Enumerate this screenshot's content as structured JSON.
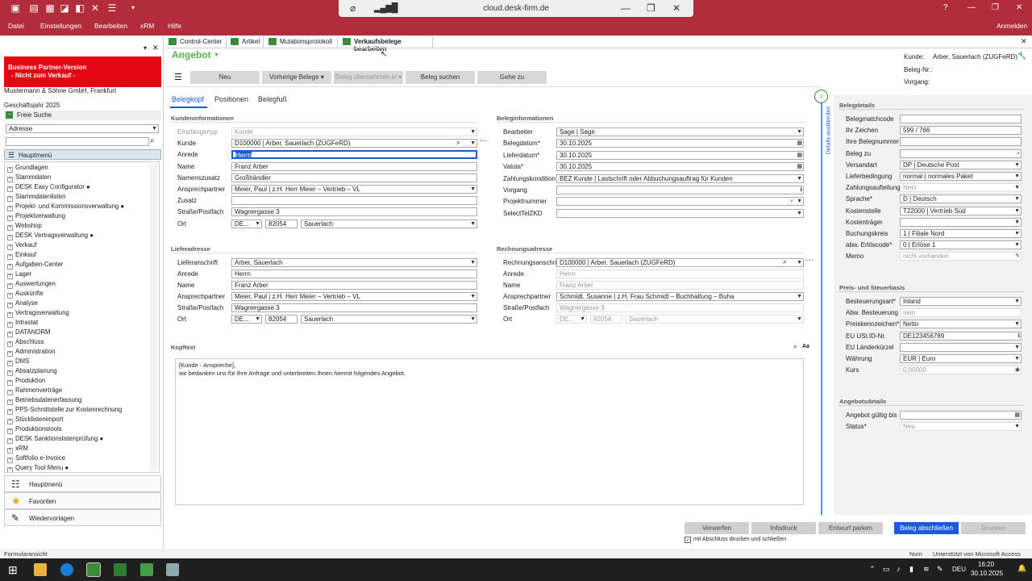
{
  "quick_access": {
    "icons": [
      "save-icon",
      "document-icon",
      "table-icon",
      "edit-icon",
      "back-icon",
      "close-icon",
      "layout-icon",
      "more-icon"
    ]
  },
  "cloud": {
    "host": "cloud.desk-firm.de"
  },
  "menu": [
    "Datei",
    "Einstellungen",
    "Bearbeiten",
    "xRM",
    "Hilfe"
  ],
  "window": {
    "help": "?",
    "login": "Anmelden"
  },
  "left": {
    "banner_line1": "Business Partner-Version",
    "banner_line2": "- Nicht zum Verkauf -",
    "company": "Mustermann & Söhne GmbH, Frankfurt",
    "fiscal": "Geschäftsjahr 2025",
    "search_title": "Freie Suche",
    "search_type": "Adresse",
    "search_value": "",
    "main_menu": "Hauptmenü",
    "tree": [
      "Grundlagen",
      "Stammdaten",
      "DESK Easy Configurator ●",
      "Stammdatenlisten",
      "Projekt- und Kommissionsverwaltung ●",
      "Projektverwaltung",
      "Webshop",
      "DESK Vertragsverwaltung ●",
      "Verkauf",
      "Einkauf",
      "Aufgaben-Center",
      "Lager",
      "Auswertungen",
      "Auskünfte",
      "Analyse",
      "Vertragsverwaltung",
      "Intrastat",
      "DATANORM",
      "Abschluss",
      "Administration",
      "DMS",
      "Absatzplanung",
      "Produktion",
      "Rahmenverträge",
      "Betriebsdatenerfassung",
      "PPS-Schnittstelle zur Kostenrechnung",
      "Stücklistenimport",
      "Produktionstools",
      "DESK Sanktionslistenprüfung ●",
      "xRM",
      "Softfolio e-Invoice",
      "Query Tool Menu ●"
    ],
    "nav": [
      "Hauptmenü",
      "Favoriten",
      "Wiedervorlagen"
    ]
  },
  "tabs": [
    "Control-Center",
    "Artikel",
    "Mutationsprotokoll",
    "Verkaufsbelege bearbeiten"
  ],
  "doc_title": "Angebot",
  "toolbar": {
    "neu": "Neu",
    "vorherige": "Vorherige Belege",
    "uebernehmen": "Beleg übernehmen in",
    "suchen": "Beleg suchen",
    "gehe": "Gehe zu"
  },
  "info": {
    "kunde_label": "Kunde:",
    "kunde_value": "Arber, Sauerlach (ZUGFeRD)",
    "belegnr_label": "Beleg-Nr.:",
    "vorgang_label": "Vorgang:"
  },
  "subtabs": [
    "Belegkopf",
    "Positionen",
    "Belegfuß"
  ],
  "kunden": {
    "title": "Kundeninformationen",
    "rows": [
      {
        "label": "Empfängertyp",
        "value": "Kunde",
        "gray": true
      },
      {
        "label": "Kunde",
        "value": "D100000 | Arber, Sauerlach (ZUGFeRD)"
      },
      {
        "label": "Anrede",
        "value": "Herrn"
      },
      {
        "label": "Name",
        "value": "Franz Arber"
      },
      {
        "label": "Namenszusatz",
        "value": "Großhändler"
      },
      {
        "label": "Ansprechpartner",
        "value": "Meier, Paul | z.H. Herr Meier – Vertrieb – VL"
      },
      {
        "label": "Zusatz",
        "value": ""
      },
      {
        "label": "Straße/Postfach",
        "value": "Wagnergasse 3"
      },
      {
        "label": "Ort",
        "country": "DE...",
        "plz": "82054",
        "city": "Sauerlach"
      }
    ]
  },
  "beleg": {
    "title": "Beleginformationen",
    "rows": [
      {
        "label": "Bearbeiter",
        "value": "Sage | Sage"
      },
      {
        "label": "Belegdatum*",
        "value": "30.10.2025"
      },
      {
        "label": "Lieferdatum*",
        "value": "30.10.2025"
      },
      {
        "label": "Valuta*",
        "value": "30.10.2025"
      },
      {
        "label": "Zahlungskondition",
        "value": "BEZ Kunde | Lastschrift oder Abbuchungsauftrag für Kunden"
      },
      {
        "label": "Vorgang",
        "value": ""
      },
      {
        "label": "Projektnummer",
        "value": ""
      },
      {
        "label": "SelectTelZKD",
        "value": ""
      }
    ]
  },
  "liefer": {
    "title": "Lieferadresse",
    "rows": [
      {
        "label": "Lieferanschrift",
        "value": "Arber, Sauerlach"
      },
      {
        "label": "Anrede",
        "value": "Herrn"
      },
      {
        "label": "Name",
        "value": "Franz Arber"
      },
      {
        "label": "Ansprechpartner",
        "value": "Meier, Paul | z.H. Herr Meier – Vertrieb – VL"
      },
      {
        "label": "Straße/Postfach",
        "value": "Wagnergasse 3"
      },
      {
        "label": "Ort",
        "country": "DE...",
        "plz": "82054",
        "city": "Sauerlach"
      }
    ]
  },
  "rechnung": {
    "title": "Rechnungsadresse",
    "rows": [
      {
        "label": "Rechnungsanschrift",
        "value": "D100000 | Arber, Sauerlach (ZUGFeRD)"
      },
      {
        "label": "Anrede",
        "value": "Herrn",
        "gray": true
      },
      {
        "label": "Name",
        "value": "Franz Arber",
        "gray": true
      },
      {
        "label": "Ansprechpartner",
        "value": "Schmidt, Susanne | z.H. Frau Schmidt – Buchhaltung – Buha"
      },
      {
        "label": "Straße/Postfach",
        "value": "Wagnergasse 3",
        "gray": true
      },
      {
        "label": "Ort",
        "country": "DE...",
        "plz": "82054",
        "city": "Sauerlach",
        "gray": true
      }
    ]
  },
  "kopftext": {
    "title": "Kopftext",
    "line1": "[Kunde - Anspreche],",
    "line2": "wir bedanken uns für Ihre Anfrage und unterbreiten Ihnen hiermit folgendes Angebot.",
    "aa": "Aa"
  },
  "details_toggle": "Details ausblenden",
  "right": {
    "belegdetails_title": "Belegdetails",
    "belegdetails": [
      {
        "label": "Belegmatchcode",
        "value": ""
      },
      {
        "label": "Ihr Zeichen",
        "value": "599 / 766"
      },
      {
        "label": "Ihre Belegnummer",
        "value": ""
      },
      {
        "label": "Beleg zu",
        "value": ""
      },
      {
        "label": "Versandart",
        "value": "DP | Deutsche Post"
      },
      {
        "label": "Lieferbedingung",
        "value": "normal | normales Paket"
      },
      {
        "label": "Zahlungsaufteilung",
        "value": "Nein",
        "gray": true
      },
      {
        "label": "Sprache*",
        "value": "D | Deutsch"
      },
      {
        "label": "Kostenstelle",
        "value": "T22000 | Vertrieb Süd"
      },
      {
        "label": "Kostenträger",
        "value": ""
      },
      {
        "label": "Buchungskreis",
        "value": "1 | Filiale Nord"
      },
      {
        "label": "abw. Erlöscode*",
        "value": "0 | Erlöse 1"
      },
      {
        "label": "Memo",
        "value": "nicht vorhanden",
        "gray": true
      }
    ],
    "preis_title": "Preis- und Steuerbasis",
    "preis": [
      {
        "label": "Besteuerungsart*",
        "value": "Inland"
      },
      {
        "label": "Abw. Besteuerung",
        "value": "nein",
        "gray": true
      },
      {
        "label": "Preiskennzeichen*",
        "value": "Netto"
      },
      {
        "label": "EU USt.ID-Nr.",
        "value": "DE123456789"
      },
      {
        "label": "EU Länderkürzel",
        "value": ""
      },
      {
        "label": "Währung",
        "value": "EUR | Euro"
      },
      {
        "label": "Kurs",
        "value": "0,00000",
        "gray": true
      }
    ],
    "angebot_title": "Angebotsdetails",
    "angebot": [
      {
        "label": "Angebot gültig bis",
        "value": ""
      },
      {
        "label": "Status*",
        "value": "Neu",
        "gray": true
      }
    ]
  },
  "bottom": {
    "verwerfen": "Verwerfen",
    "infodruck": "Infodruck",
    "entwurf": "Entwurf parken",
    "abschliessen": "Beleg abschließen",
    "drucken": "Drucken",
    "checkbox": "mit Abschluss drucken und schließen"
  },
  "status": {
    "left": "Formularansicht",
    "num": "Num",
    "right": "Unterstützt von Microsoft Access"
  },
  "taskbar": {
    "lang": "DEU",
    "time": "16:20",
    "date": "30.10.2025"
  },
  "colors": {
    "title_bg": "#b22d3c",
    "banner": "#e30613",
    "accent": "#1c5bd6",
    "doc_title": "#56b34a"
  }
}
